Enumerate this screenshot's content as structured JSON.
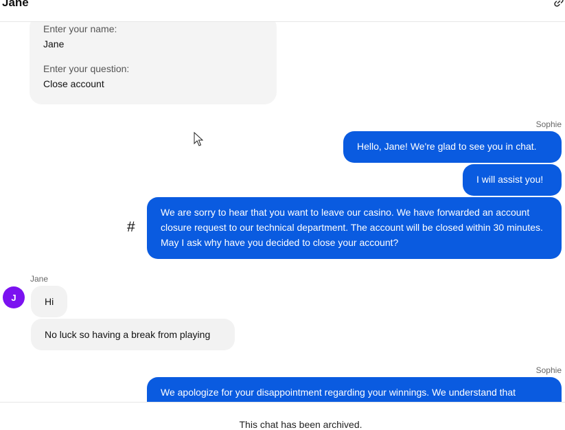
{
  "header": {
    "title": "Jane",
    "link_icon": "link-icon"
  },
  "form": {
    "name_label": "Enter your name:",
    "name_value": "Jane",
    "question_label": "Enter your question:",
    "question_value": "Close account"
  },
  "messages": [
    {
      "sender": "Sophie",
      "role": "agent",
      "text": "Hello, Jane! We're glad to see you in chat."
    },
    {
      "sender": "Sophie",
      "role": "agent",
      "text": "I will assist you!"
    },
    {
      "sender": "Sophie",
      "role": "agent",
      "text": "We are sorry to hear that you want to leave our casino. We have forwarded an account closure request to our technical department. The account will be closed within 30 minutes. May I ask why have you decided to close your account?"
    },
    {
      "sender": "Jane",
      "role": "user",
      "text": "Hi"
    },
    {
      "sender": "Jane",
      "role": "user",
      "text": "No luck so having a break from playing"
    },
    {
      "sender": "Sophie",
      "role": "agent",
      "text": "We apologize for your disappointment regarding your winnings. We understand that"
    }
  ],
  "senders": {
    "agent": "Sophie",
    "user": "Jane"
  },
  "avatar_initial": "J",
  "hash_symbol": "#",
  "footer": {
    "status": "This chat has been archived."
  },
  "colors": {
    "agent_bubble": "#0a5be0",
    "user_bubble": "#f2f2f2",
    "avatar": "#7b12f0"
  }
}
